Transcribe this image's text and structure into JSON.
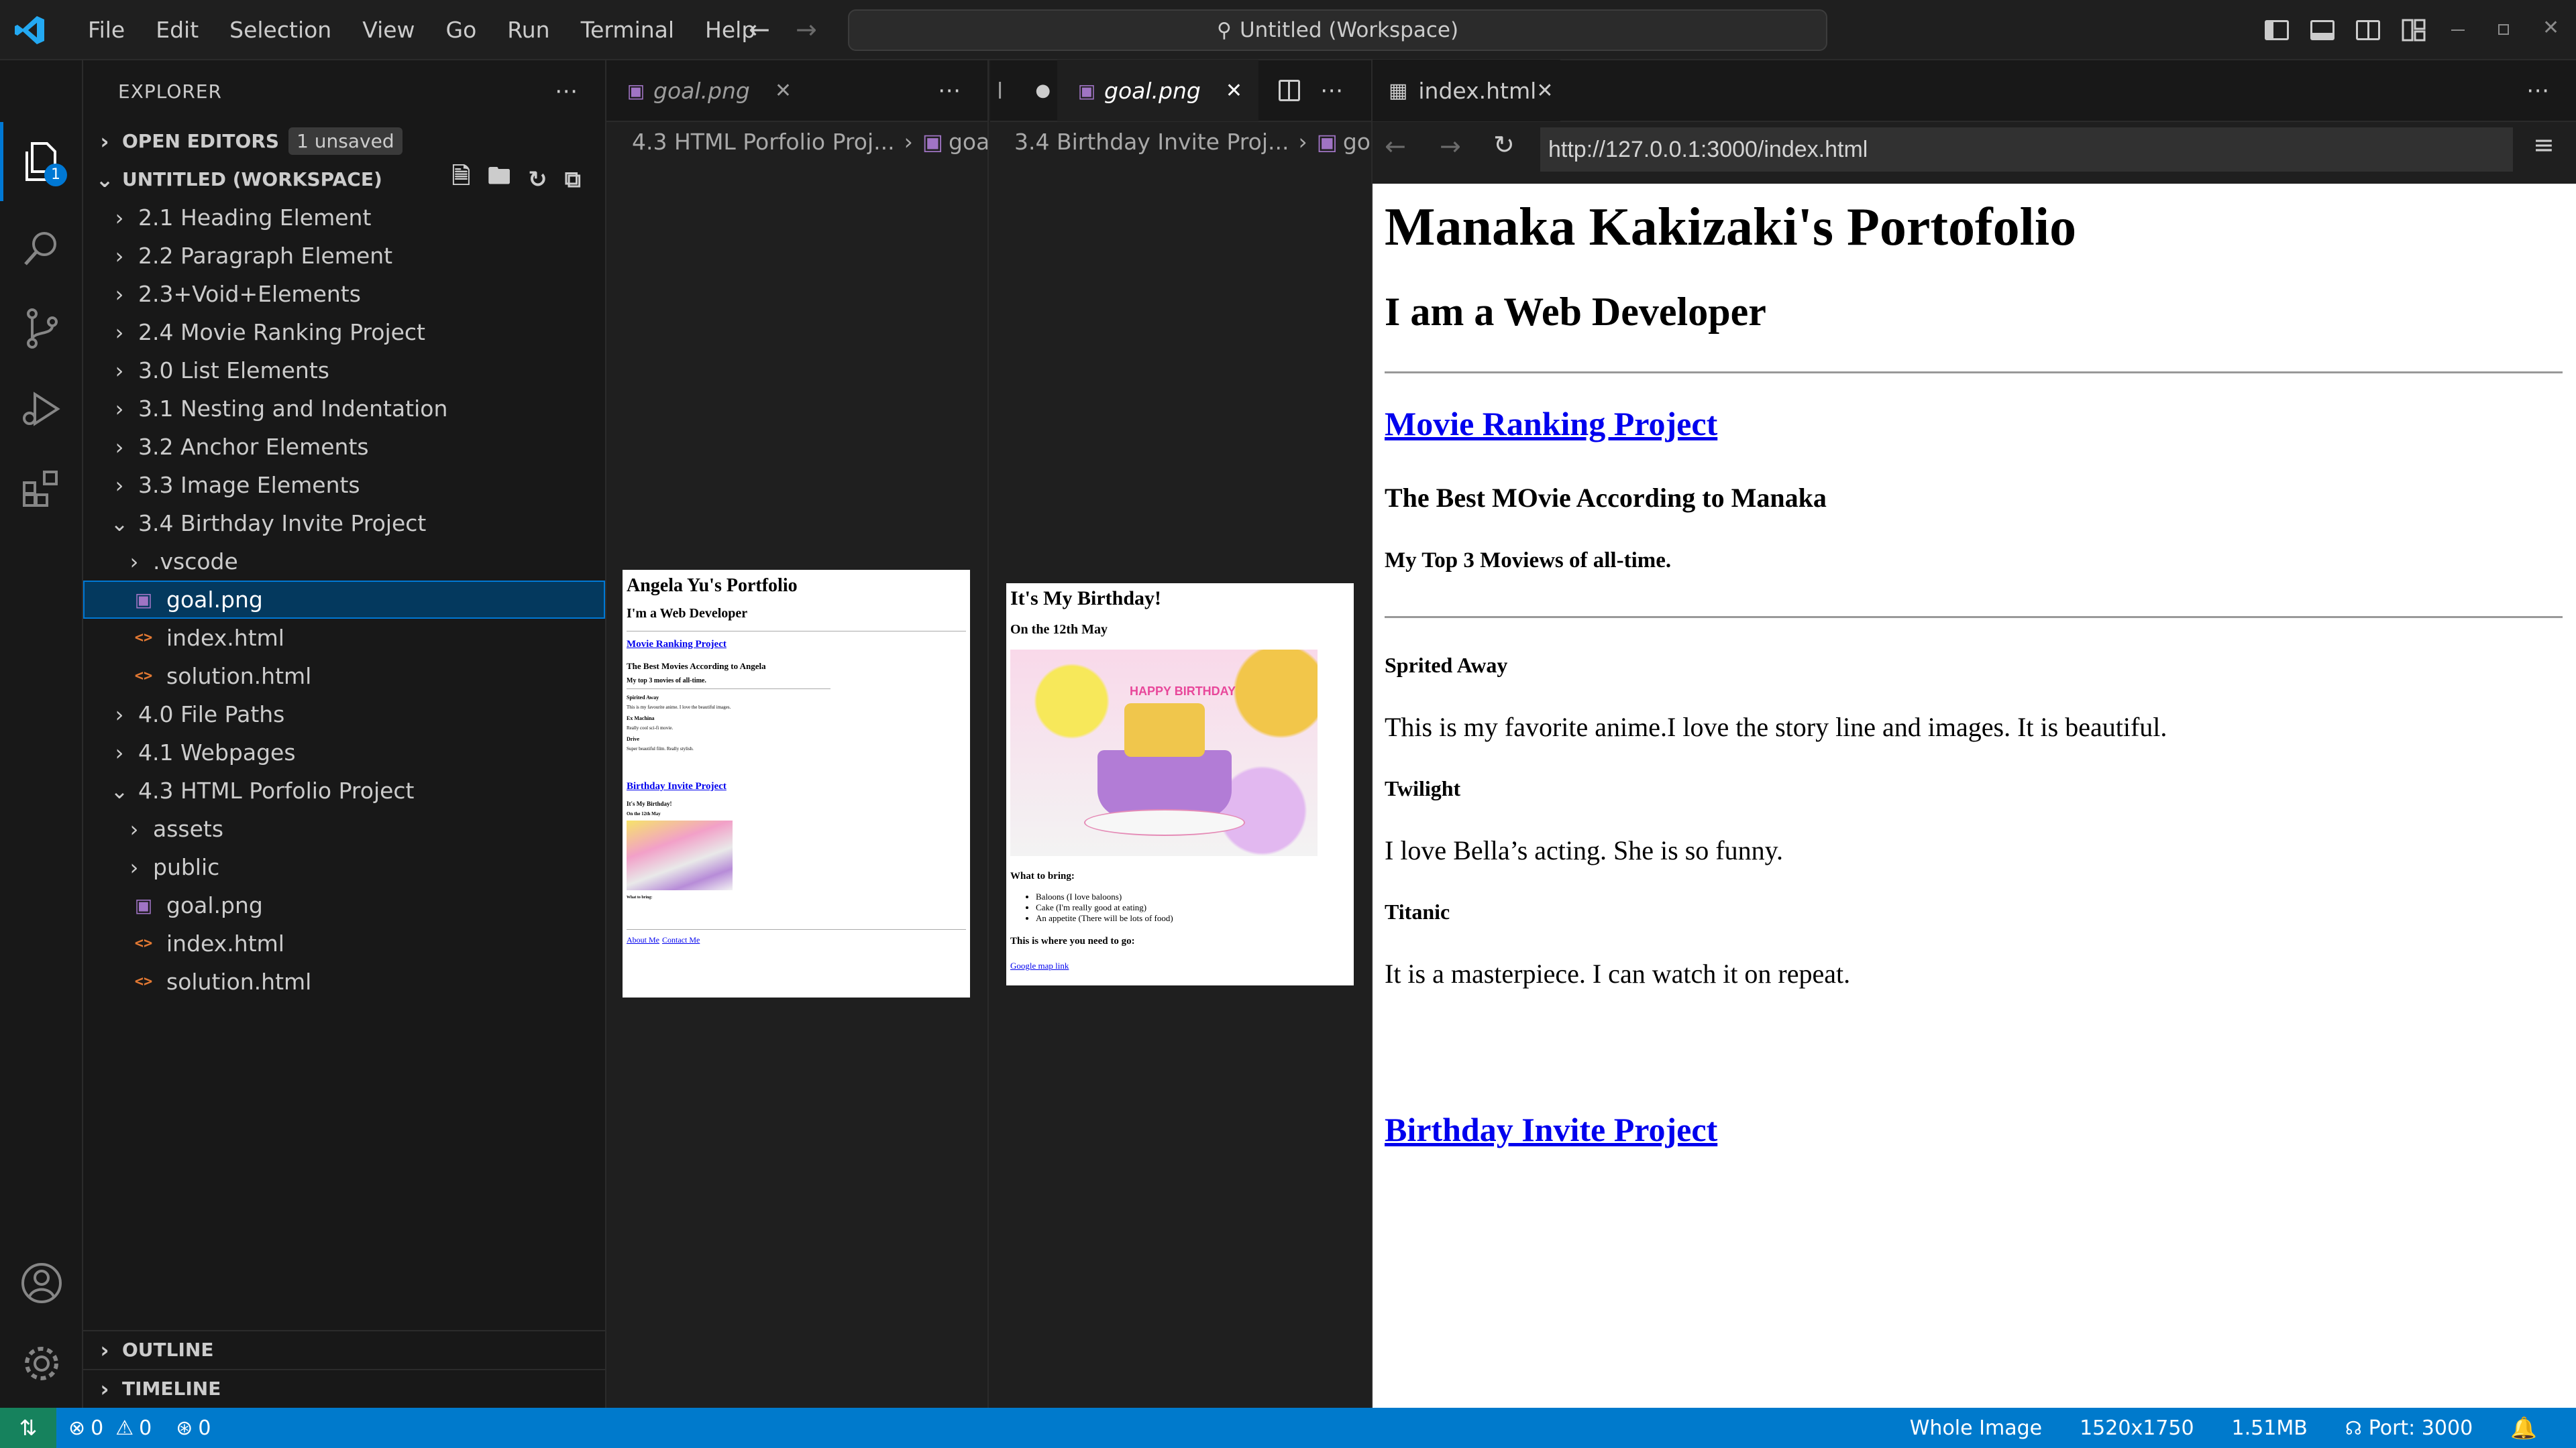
{
  "titlebar": {
    "menu": [
      "File",
      "Edit",
      "Selection",
      "View",
      "Go",
      "Run",
      "Terminal",
      "Help"
    ],
    "search": "Untitled (Workspace)"
  },
  "activity": {
    "explorer_badge": "1"
  },
  "sidebar": {
    "title": "EXPLORER",
    "open_editors": "OPEN EDITORS",
    "unsaved": "1 unsaved",
    "workspace": "UNTITLED (WORKSPACE)",
    "tree": [
      {
        "label": "2.1 Heading Element",
        "type": "folder",
        "open": false,
        "depth": 0
      },
      {
        "label": "2.2 Paragraph Element",
        "type": "folder",
        "open": false,
        "depth": 0
      },
      {
        "label": "2.3+Void+Elements",
        "type": "folder",
        "open": false,
        "depth": 0
      },
      {
        "label": "2.4 Movie Ranking Project",
        "type": "folder",
        "open": false,
        "depth": 0
      },
      {
        "label": "3.0 List Elements",
        "type": "folder",
        "open": false,
        "depth": 0
      },
      {
        "label": "3.1 Nesting and Indentation",
        "type": "folder",
        "open": false,
        "depth": 0
      },
      {
        "label": "3.2 Anchor Elements",
        "type": "folder",
        "open": false,
        "depth": 0
      },
      {
        "label": "3.3 Image Elements",
        "type": "folder",
        "open": false,
        "depth": 0
      },
      {
        "label": "3.4 Birthday Invite Project",
        "type": "folder",
        "open": true,
        "depth": 0
      },
      {
        "label": ".vscode",
        "type": "folder",
        "open": false,
        "depth": 1
      },
      {
        "label": "goal.png",
        "type": "img",
        "depth": 1,
        "selected": true
      },
      {
        "label": "index.html",
        "type": "html",
        "depth": 1
      },
      {
        "label": "solution.html",
        "type": "html",
        "depth": 1
      },
      {
        "label": "4.0 File Paths",
        "type": "folder",
        "open": false,
        "depth": 0
      },
      {
        "label": "4.1 Webpages",
        "type": "folder",
        "open": false,
        "depth": 0
      },
      {
        "label": "4.3 HTML Porfolio Project",
        "type": "folder",
        "open": true,
        "depth": 0
      },
      {
        "label": "assets",
        "type": "folder",
        "open": false,
        "depth": 1
      },
      {
        "label": "public",
        "type": "folder",
        "open": false,
        "depth": 1
      },
      {
        "label": "goal.png",
        "type": "img",
        "depth": 1
      },
      {
        "label": "index.html",
        "type": "html",
        "depth": 1
      },
      {
        "label": "solution.html",
        "type": "html",
        "depth": 1
      }
    ],
    "outline": "OUTLINE",
    "timeline": "TIMELINE"
  },
  "group1": {
    "tab": "goal.png",
    "breadcrumb_folder": "4.3 HTML Porfolio Proj...",
    "breadcrumb_file": "goa",
    "preview": {
      "h1": "Angela Yu's Portfolio",
      "h2": "I'm a Web Developer",
      "link1": "Movie Ranking Project",
      "h3": "The Best Movies According to Angela",
      "h4": "My top 3 movies of all-time.",
      "m1": "Spirited Away",
      "m1d": "This is my favourite anime. I love the beautiful images.",
      "m2": "Ex Machina",
      "m2d": "Really cool sci-fi movie.",
      "m3": "Drive",
      "m3d": "Super beautiful film. Really stylish.",
      "link2": "Birthday Invite Project",
      "b1": "It's My Birthday!",
      "b2": "On the 12th May",
      "b3": "What to bring:",
      "footer1": "About Me",
      "footer2": "Contact Me"
    }
  },
  "group2": {
    "tab_prev": "l",
    "tab": "goal.png",
    "breadcrumb_folder": "3.4 Birthday Invite Proj...",
    "breadcrumb_file": "goa",
    "preview": {
      "h1": "It's My Birthday!",
      "h3": "On the 12th May",
      "bring": "What to bring:",
      "items": [
        "Baloons (I love baloons)",
        "Cake (I'm really good at eating)",
        "An appetite (There will be lots of food)"
      ],
      "where": "This is where you need to go:",
      "link": "Google map link",
      "cake_text": "HAPPY BIRTHDAY"
    }
  },
  "browser": {
    "tab": "index.html",
    "url": "http://127.0.0.1:3000/index.html",
    "page": {
      "h1": "Manaka Kakizaki's Portofolio",
      "h2": "I am a Web Developer",
      "link1": "Movie Ranking Project",
      "h3": "The Best MOvie According to Manaka",
      "h4": "My Top 3 Moviews of all-time.",
      "movies": [
        {
          "title": "Sprited Away",
          "desc": "This is my favorite anime.I love the story line and images. It is beautiful."
        },
        {
          "title": "Twilight",
          "desc": "I love Bella’s acting. She is so funny."
        },
        {
          "title": "Titanic",
          "desc": "It is a masterpiece. I can watch it on repeat."
        }
      ],
      "link2": "Birthday Invite Project"
    }
  },
  "status": {
    "errors": "0",
    "warnings": "0",
    "ports": "0",
    "view": "Whole Image",
    "dims": "1520x1750",
    "size": "1.51MB",
    "port": "Port: 3000"
  }
}
